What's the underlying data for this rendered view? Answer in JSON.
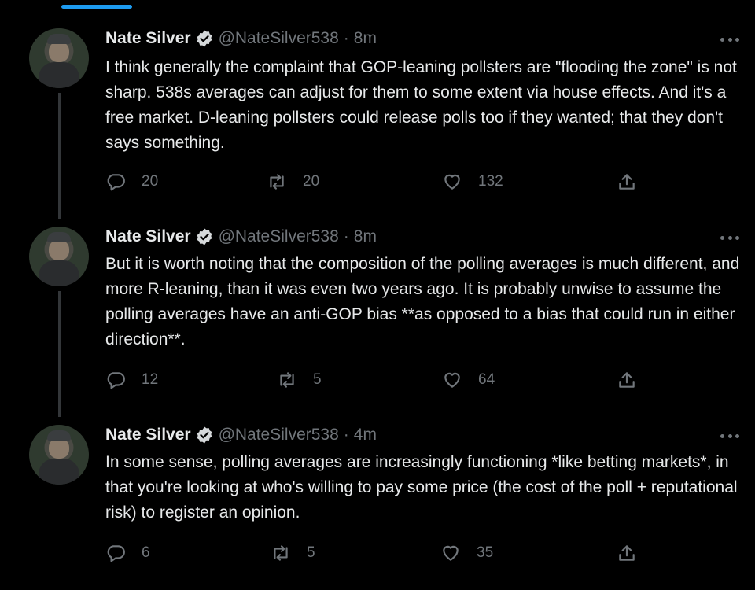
{
  "tweets": [
    {
      "author": "Nate Silver",
      "handle": "@NateSilver538",
      "separator": "·",
      "time": "8m",
      "text": "I think generally the complaint that GOP-leaning pollsters are \"flooding the zone\" is not sharp. 538s averages can adjust for them to some extent via house effects. And it's a free market. D-leaning pollsters could release polls too if they wanted; that they don't says something.",
      "replies": "20",
      "retweets": "20",
      "likes": "132"
    },
    {
      "author": "Nate Silver",
      "handle": "@NateSilver538",
      "separator": "·",
      "time": "8m",
      "text": "But it is worth noting that the composition of the polling averages is much different, and more R-leaning, than it was even two years ago. It is probably unwise to assume the polling averages have an anti-GOP bias **as opposed to a bias that could run in either direction**.",
      "replies": "12",
      "retweets": "5",
      "likes": "64"
    },
    {
      "author": "Nate Silver",
      "handle": "@NateSilver538",
      "separator": "·",
      "time": "4m",
      "text": "In some sense, polling averages are increasingly functioning *like betting markets*, in that you're looking at who's willing to pay some price (the cost of the poll + reputational risk) to register an opinion.",
      "replies": "6",
      "retweets": "5",
      "likes": "35"
    }
  ],
  "icons": {
    "reply": "reply-icon",
    "retweet": "retweet-icon",
    "like": "heart-icon",
    "share": "share-icon",
    "verified": "verified-badge-icon",
    "more": "more-options-icon"
  },
  "colors": {
    "background": "#000000",
    "text": "#e7e9ea",
    "muted": "#71767b",
    "accent": "#1d9bf0"
  }
}
